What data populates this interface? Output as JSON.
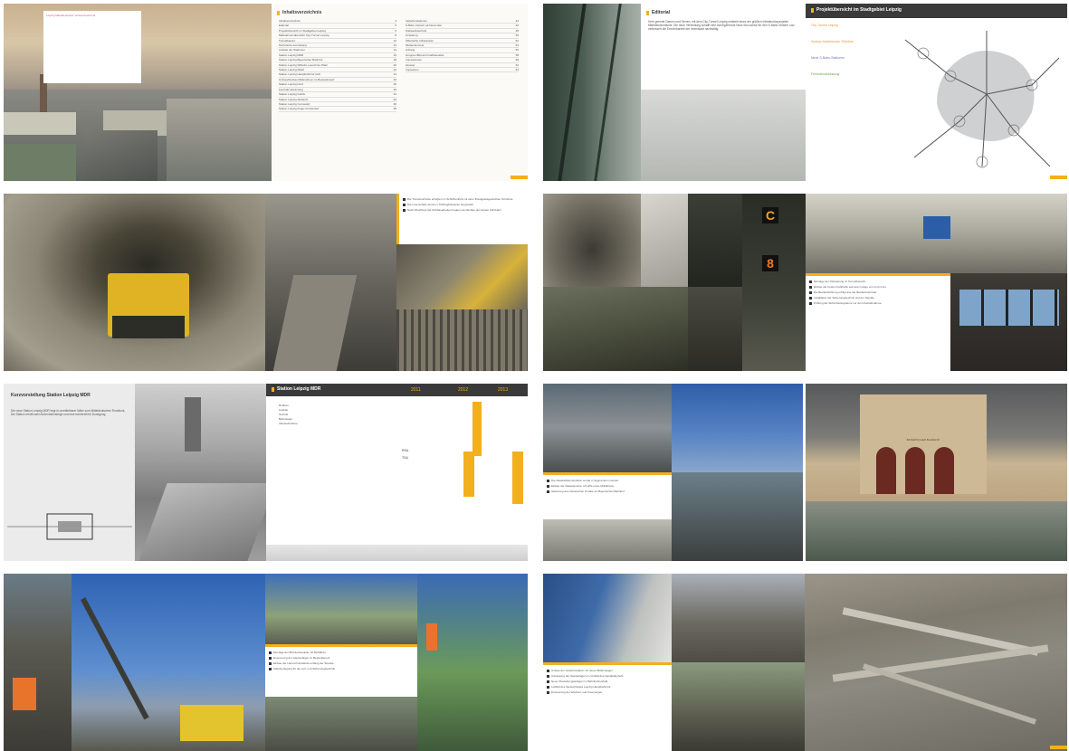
{
  "pages": {
    "p1": {
      "inhaltsverzeichnis_title": "Inhaltsverzeichnis",
      "toc_left": [
        {
          "label": "Inhaltsverzeichnis",
          "page": "3"
        },
        {
          "label": "Editorial",
          "page": "5"
        },
        {
          "label": "Projektübersicht im Stadtgebiet Leipzig",
          "page": "6"
        },
        {
          "label": "Maßnahmenübersicht City-Tunnel Leipzig",
          "page": "8"
        },
        {
          "label": "Tunnelbauten",
          "page": "10"
        },
        {
          "label": "Technische Ausrüstung",
          "page": "12"
        },
        {
          "label": "Ausbau der Stationen",
          "page": "14"
        },
        {
          "label": "Station Leipzig MDR",
          "page": "16"
        },
        {
          "label": "Station Leipzig Bayerischer Bahnhof",
          "page": "18"
        },
        {
          "label": "Station Leipzig Wilhelm-Leuschner-Platz",
          "page": "20"
        },
        {
          "label": "Station Leipzig Markt",
          "page": "22"
        },
        {
          "label": "Station Leipzig Hauptbahnhof (tief)",
          "page": "24"
        },
        {
          "label": "Umbau/Ausbau Maßnahmen im Bestandsnetz",
          "page": "26"
        },
        {
          "label": "Station Leipzig Nord",
          "page": "28"
        },
        {
          "label": "Fernbahnanbindung",
          "page": "30"
        },
        {
          "label": "Station Leipzig Gohlis",
          "page": "32"
        },
        {
          "label": "Station Leipzig Stötteritz",
          "page": "34"
        },
        {
          "label": "Station Leipzig Connewitz",
          "page": "36"
        },
        {
          "label": "Station Leipzig Anger-Crottendorf",
          "page": "38"
        }
      ],
      "toc_right": [
        {
          "label": "Verkehrsstationen",
          "page": "44"
        },
        {
          "label": "S-Bahn-Verkehr ab Dezember",
          "page": "46"
        },
        {
          "label": "Stellwerkstechnik",
          "page": "48"
        },
        {
          "label": "Umleitung",
          "page": "50"
        },
        {
          "label": "Öffentliche Infrastruktur",
          "page": "52"
        },
        {
          "label": "Medienkonzept",
          "page": "54"
        },
        {
          "label": "Anhang",
          "page": "56"
        },
        {
          "label": "Gruppen-Bild auf Großbaustelle",
          "page": "58"
        },
        {
          "label": "Impressionen",
          "page": "60"
        },
        {
          "label": "Glossar",
          "page": "62"
        },
        {
          "label": "Impressum",
          "page": "64"
        }
      ],
      "overlay_text": "Leipzig Mitteldeutscher Verkehrsverbund"
    },
    "p2": {
      "editorial_title": "Editorial",
      "editorial_body": "Sehr geehrte Damen und Herren, mit dem City-Tunnel Leipzig entsteht eines der größten Infrastrukturprojekte Mitteldeutschlands. Die neue Verbindung schafft eine durchgehende Nord-Süd-Achse für den S-Bahn-Verkehr und verbessert die Erreichbarkeit der Innenstadt nachhaltig.",
      "projekt_title": "Projektübersicht im Stadtgebiet Leipzig",
      "map_legend": [
        "City-Tunnel Leipzig",
        "Ausbau bestehender Strecken",
        "Neue S-Bahn-Stationen",
        "Fernbahnanbindung"
      ]
    },
    "p3": {
      "bullets": [
        "Die Tunnelvortriebe erfolgten im Schildvortrieb mit einer flüssigkeitsgestützten Ortsbrust.",
        "Die Innenschale wurde in Tübbingbauweise hergestellt.",
        "Nach Abschluss der Rohbauarbeiten begann der Einbau der Festen Fahrbahn."
      ]
    },
    "p4": {
      "signal_c": "C",
      "signal_8": "8",
      "bullets": [
        "Montage der Oberleitung im Tunnelbereich.",
        "Einbau der Festen Fahrbahn auf einer Länge von rund 4 km.",
        "Die Betriebsführung erfolgt aus der Betriebszentrale.",
        "Installation der Sicherungstechnik und der Signale.",
        "Prüfung der Sicherheitssysteme vor der Inbetriebnahme."
      ]
    },
    "p5": {
      "heading": "Kurzvorstellung Station Leipzig MDR",
      "body": "Die neue Station Leipzig MDR liegt in unmittelbarer Nähe zum Mitteldeutschen Rundfunk. Die Station erhält zwei Außenbahnsteige und eine barrierefreie Zuwegung.",
      "timeline_title": "Station Leipzig MDR",
      "years": [
        "2011",
        "2012",
        "2013"
      ],
      "timeline_items": [
        "Rohbau",
        "Ausbau",
        "Technik",
        "Bahnsteige",
        "Inbetriebnahme"
      ],
      "rows": [
        "RSA",
        "TSA"
      ]
    },
    "p6": {
      "bullets": [
        "Die Glasdachkonstruktion wurde in Segmenten montiert.",
        "Einbau der Glaselemente mit Hilfe eines Mobilkrans.",
        "Sanierung des historischen Portals am Bayerischen Bahnhof."
      ],
      "portal_text": "BAYERISCHER BAHNHOF"
    },
    "p7": {
      "bullets": [
        "Montage der Brückenbauteile mit Mobilkran.",
        "Erneuerung der Gleisanlagen im Bestandsnetz.",
        "Einbau der Lärmschutzwände entlang der Strecke.",
        "Kabelverlegung für die Leit- und Sicherungstechnik."
      ]
    },
    "p8": {
      "bullets": [
        "Umbau der Verkehrsstation mit neuen Bahnsteigen.",
        "Anpassung der Gleisanlagen im Vorfeld des Hauptbahnhofs.",
        "Neue Oberleitungsanlagen im Bahnhofsvorfeld.",
        "Luftbild des Gleisvorfeldes Leipzig Hauptbahnhof.",
        "Erneuerung der Weichen und Kreuzungen."
      ]
    }
  }
}
